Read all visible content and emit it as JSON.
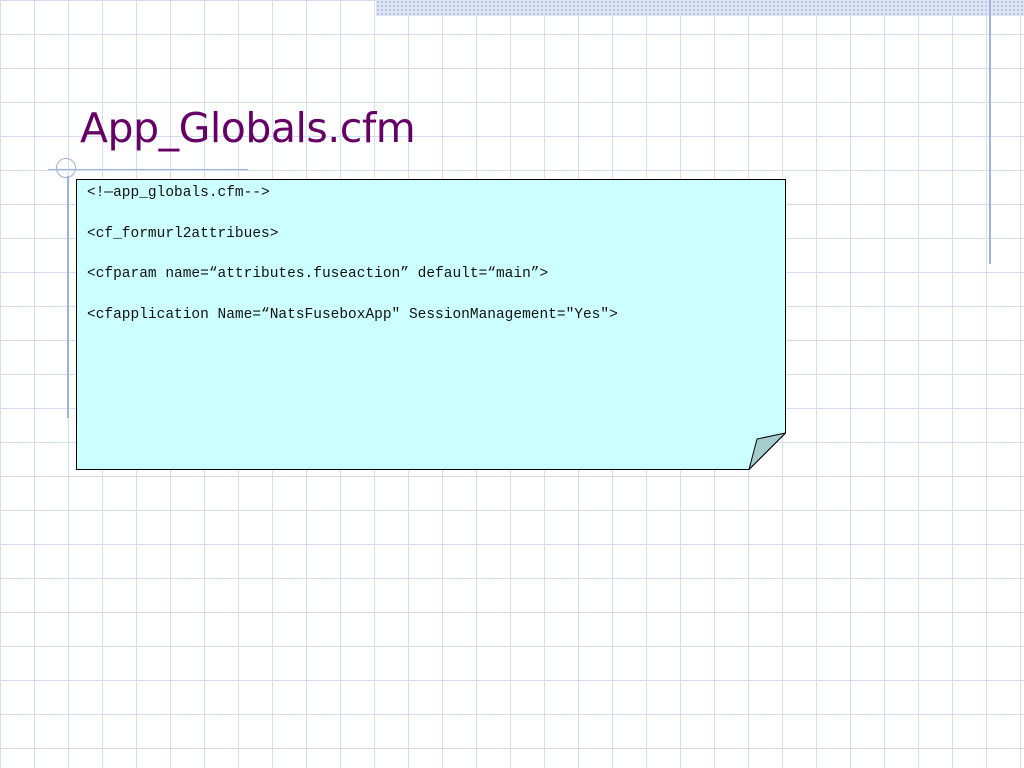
{
  "slide": {
    "title": "App_Globals.cfm",
    "title_color": "#660066",
    "note_fill": "#ccffff",
    "code_lines": [
      "<!—app_globals.cfm-->",
      "<cf_formurl2attribues>",
      "<cfparam name=“attributes.fuseaction” default=“main”>",
      "<cfapplication Name=“NatsFuseboxApp\" SessionManagement=\"Yes\">"
    ]
  }
}
